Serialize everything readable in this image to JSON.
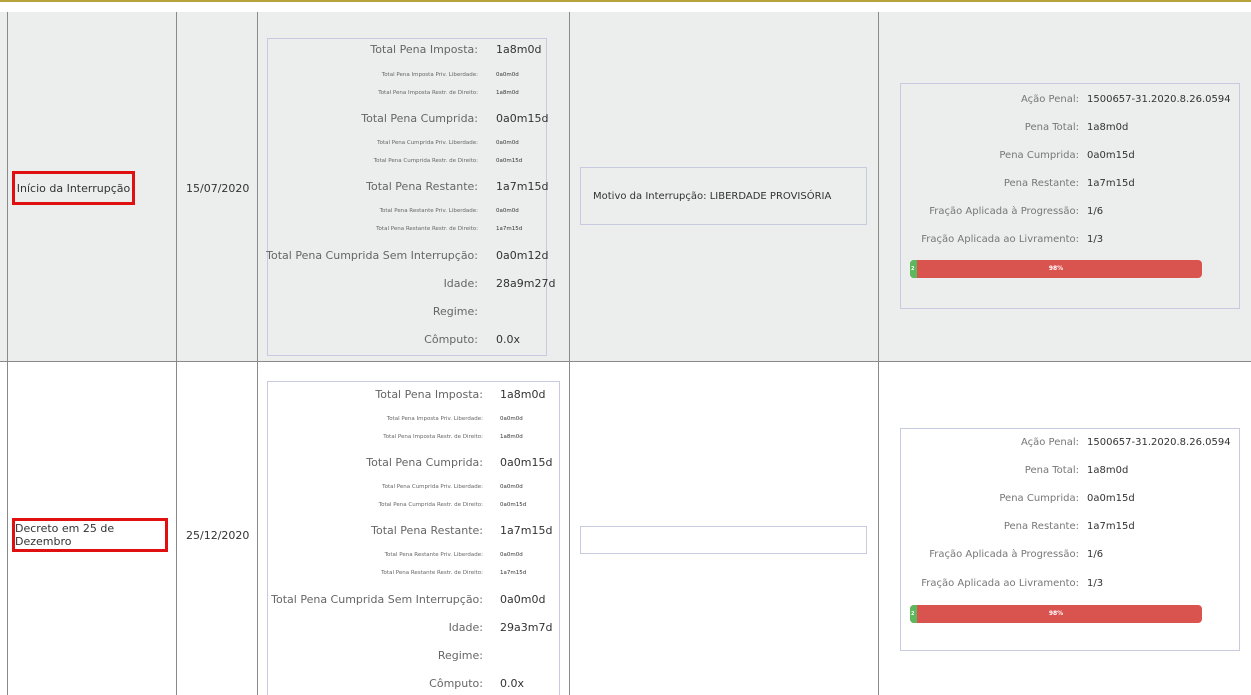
{
  "rows": [
    {
      "evento": "Início da Interrupção",
      "data": "15/07/2020",
      "pena": {
        "total_imposta_label": "Total Pena Imposta:",
        "total_imposta": "1a8m0d",
        "imposta_priv_label": "Total Pena Imposta Priv. Liberdade:",
        "imposta_priv": "0a0m0d",
        "imposta_restr_label": "Total Pena Imposta Restr. de Direito:",
        "imposta_restr": "1a8m0d",
        "total_cumprida_label": "Total Pena Cumprida:",
        "total_cumprida": "0a0m15d",
        "cumprida_priv_label": "Total Pena Cumprida Priv. Liberdade:",
        "cumprida_priv": "0a0m0d",
        "cumprida_restr_label": "Total Pena Cumprida Restr. de Direito:",
        "cumprida_restr": "0a0m15d",
        "total_restante_label": "Total Pena Restante:",
        "total_restante": "1a7m15d",
        "restante_priv_label": "Total Pena Restante Priv. Liberdade:",
        "restante_priv": "0a0m0d",
        "restante_restr_label": "Total Pena Restante Restr. de Direito:",
        "restante_restr": "1a7m15d",
        "sem_interrupcao_label": "Total Pena Cumprida Sem Interrupção:",
        "sem_interrupcao": "0a0m12d",
        "idade_label": "Idade:",
        "idade": "28a9m27d",
        "regime_label": "Regime:",
        "regime": "",
        "computo_label": "Cômputo:",
        "computo": "0.0x"
      },
      "motivo": "Motivo da Interrupção: LIBERDADE PROVISÓRIA",
      "acao": {
        "acao_penal_label": "Ação Penal:",
        "acao_penal": "1500657-31.2020.8.26.0594",
        "pena_total_label": "Pena Total:",
        "pena_total": "1a8m0d",
        "pena_cumprida_label": "Pena Cumprida:",
        "pena_cumprida": "0a0m15d",
        "pena_restante_label": "Pena Restante:",
        "pena_restante": "1a7m15d",
        "fracao_progressao_label": "Fração Aplicada à Progressão:",
        "fracao_progressao": "1/6",
        "fracao_livramento_label": "Fração Aplicada ao Livramento:",
        "fracao_livramento": "1/3",
        "progress_done_label": "2",
        "progress_remaining_label": "98%",
        "progress_done_fraction": 0.02
      }
    },
    {
      "evento": "Decreto em 25 de Dezembro",
      "data": "25/12/2020",
      "pena": {
        "total_imposta_label": "Total Pena Imposta:",
        "total_imposta": "1a8m0d",
        "imposta_priv_label": "Total Pena Imposta Priv. Liberdade:",
        "imposta_priv": "0a0m0d",
        "imposta_restr_label": "Total Pena Imposta Restr. de Direito:",
        "imposta_restr": "1a8m0d",
        "total_cumprida_label": "Total Pena Cumprida:",
        "total_cumprida": "0a0m15d",
        "cumprida_priv_label": "Total Pena Cumprida Priv. Liberdade:",
        "cumprida_priv": "0a0m0d",
        "cumprida_restr_label": "Total Pena Cumprida Restr. de Direito:",
        "cumprida_restr": "0a0m15d",
        "total_restante_label": "Total Pena Restante:",
        "total_restante": "1a7m15d",
        "restante_priv_label": "Total Pena Restante Priv. Liberdade:",
        "restante_priv": "0a0m0d",
        "restante_restr_label": "Total Pena Restante Restr. de Direito:",
        "restante_restr": "1a7m15d",
        "sem_interrupcao_label": "Total Pena Cumprida Sem Interrupção:",
        "sem_interrupcao": "0a0m0d",
        "idade_label": "Idade:",
        "idade": "29a3m7d",
        "regime_label": "Regime:",
        "regime": "",
        "computo_label": "Cômputo:",
        "computo": "0.0x"
      },
      "motivo": "",
      "acao": {
        "acao_penal_label": "Ação Penal:",
        "acao_penal": "1500657-31.2020.8.26.0594",
        "pena_total_label": "Pena Total:",
        "pena_total": "1a8m0d",
        "pena_cumprida_label": "Pena Cumprida:",
        "pena_cumprida": "0a0m15d",
        "pena_restante_label": "Pena Restante:",
        "pena_restante": "1a7m15d",
        "fracao_progressao_label": "Fração Aplicada à Progressão:",
        "fracao_progressao": "1/6",
        "fracao_livramento_label": "Fração Aplicada ao Livramento:",
        "fracao_livramento": "1/3",
        "progress_done_label": "2",
        "progress_remaining_label": "98%",
        "progress_done_fraction": 0.02
      }
    }
  ],
  "colors": {
    "highlight": "#e01010",
    "progress_remaining": "#d9534f",
    "progress_done": "#5cb85c",
    "top_border": "#b8a23c"
  }
}
